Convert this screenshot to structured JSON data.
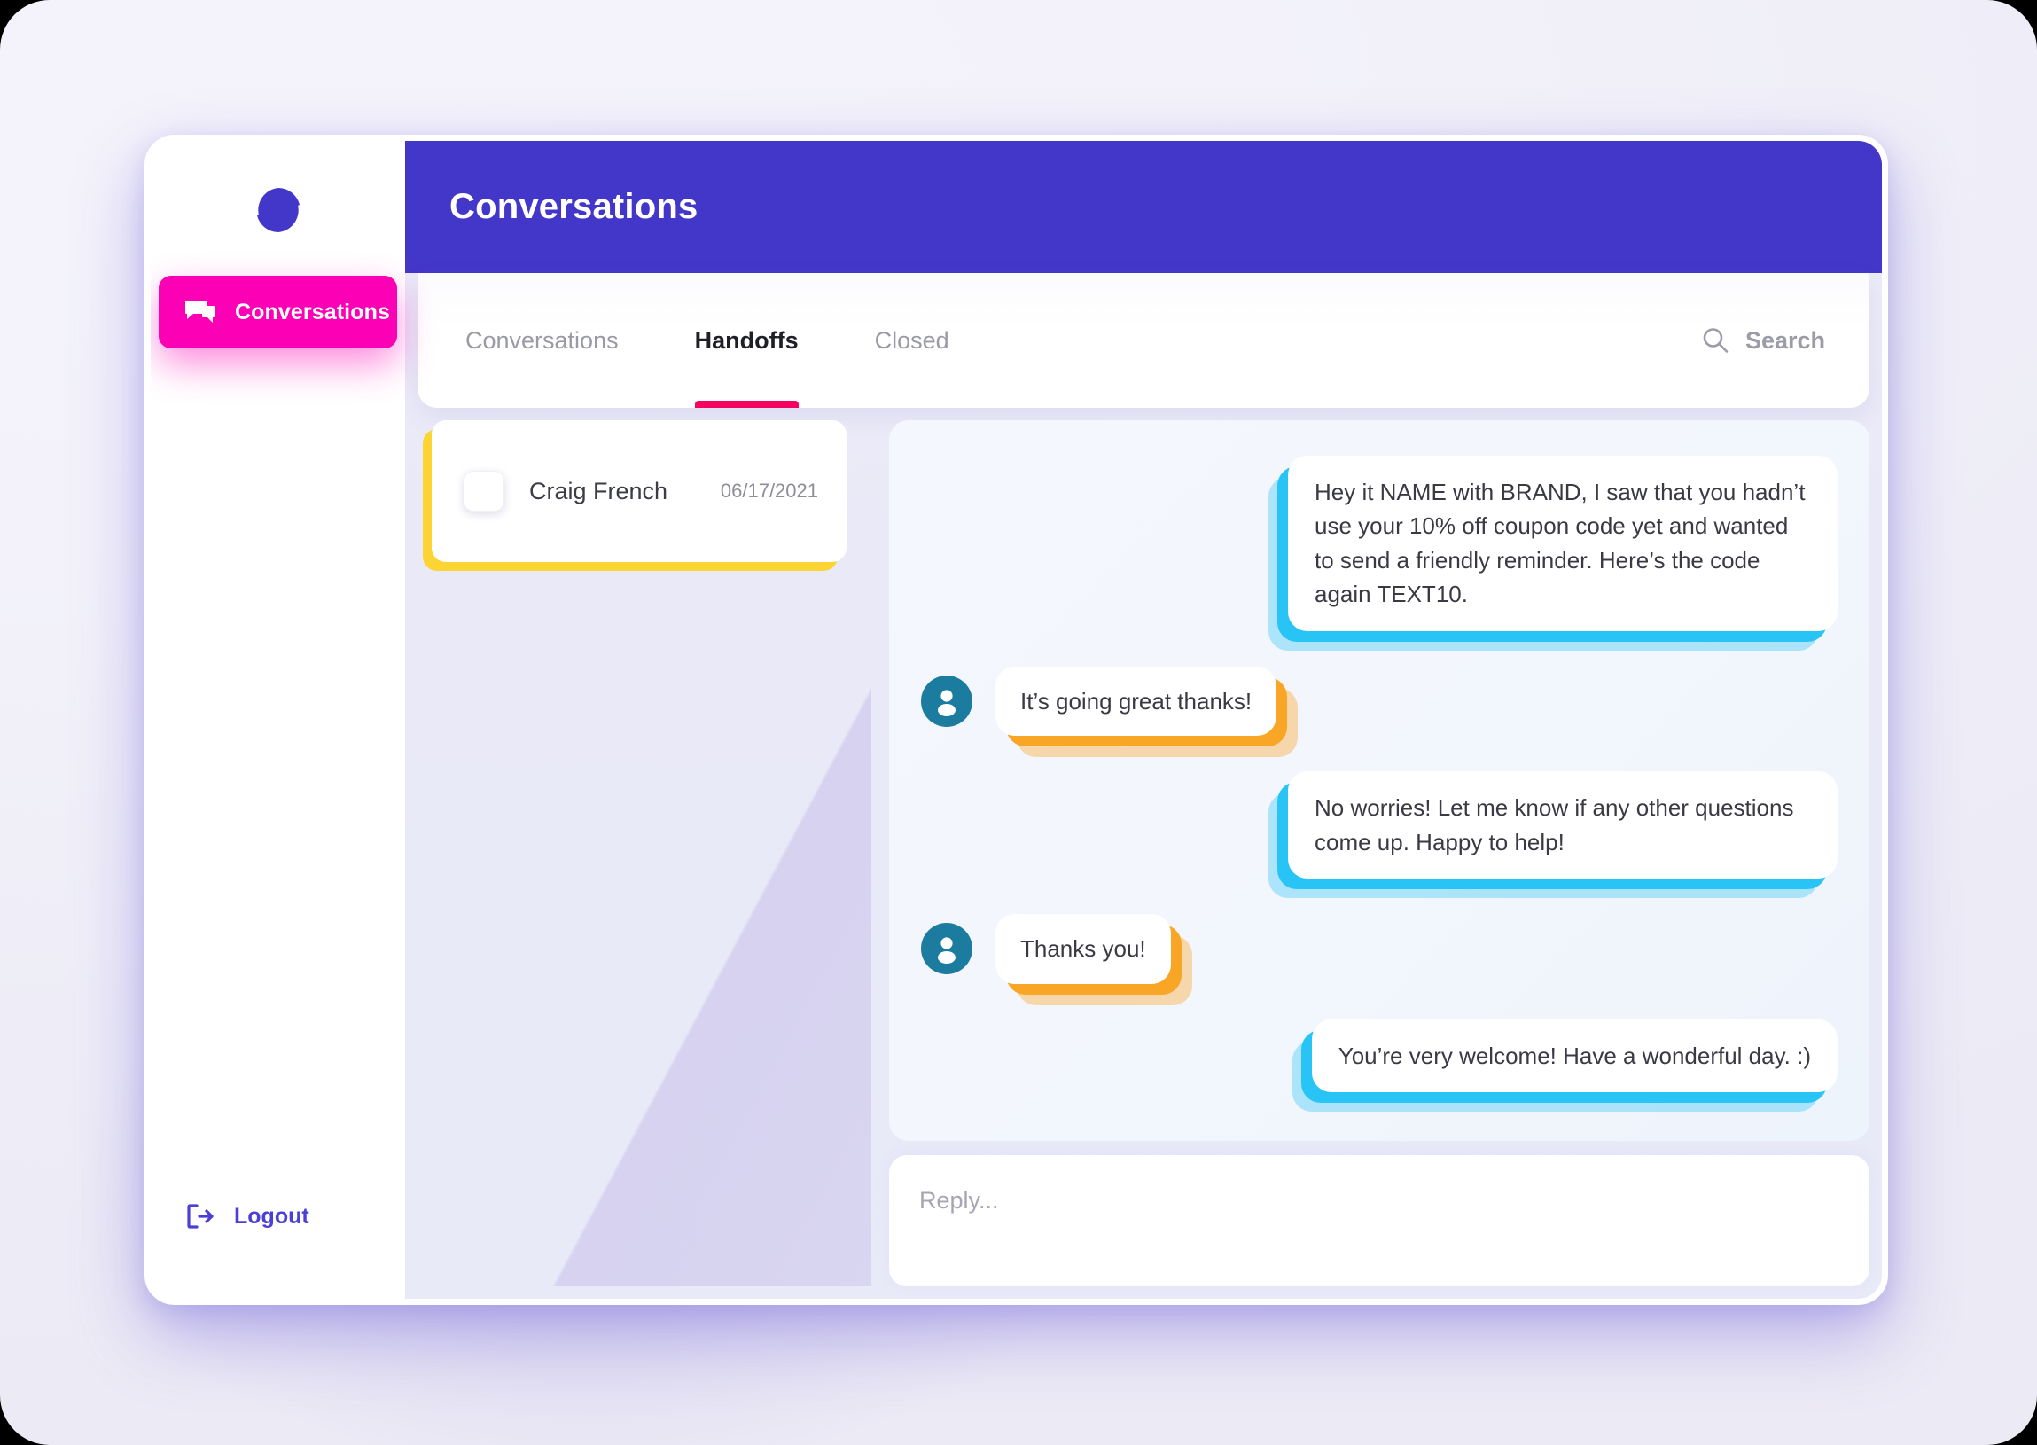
{
  "sidebar": {
    "logo_icon": "brand-circle-slash-logo",
    "items": [
      {
        "label": "Conversations",
        "icon": "chat-bubbles-icon",
        "active": true
      }
    ],
    "logout": {
      "label": "Logout",
      "icon": "logout-arrow-icon"
    }
  },
  "header": {
    "title": "Conversations"
  },
  "tabs": [
    {
      "label": "Conversations",
      "active": false
    },
    {
      "label": "Handoffs",
      "active": true
    },
    {
      "label": "Closed",
      "active": false
    }
  ],
  "search": {
    "icon": "search-icon",
    "placeholder": "Search"
  },
  "conversation_list": [
    {
      "name": "Craig French",
      "date": "06/17/2021",
      "checked": false
    }
  ],
  "thread": {
    "messages": [
      {
        "side": "agent",
        "text": "Hey it NAME with BRAND, I saw that you hadn’t use your 10% off coupon code yet and wanted to send a friendly reminder. Here’s the code again TEXT10."
      },
      {
        "side": "user",
        "text": "It’s going great thanks!"
      },
      {
        "side": "agent",
        "text": "No worries! Let me know if any other questions come up. Happy to help!"
      },
      {
        "side": "user",
        "text": "Thanks you!"
      },
      {
        "side": "agent",
        "text": "You’re very welcome! Have a wonderful day. :)"
      }
    ]
  },
  "reply": {
    "placeholder": "Reply...",
    "value": ""
  },
  "colors": {
    "header_blue": "#4337C9",
    "nav_active_pink": "#FB00B5",
    "tab_underline": "#F5045F",
    "list_card_accent": "#FCD434",
    "agent_bubble_accent": "#27C4F5",
    "user_bubble_accent": "#F9A626",
    "avatar": "#1C7C9F",
    "logout_text": "#4B3FD6"
  }
}
